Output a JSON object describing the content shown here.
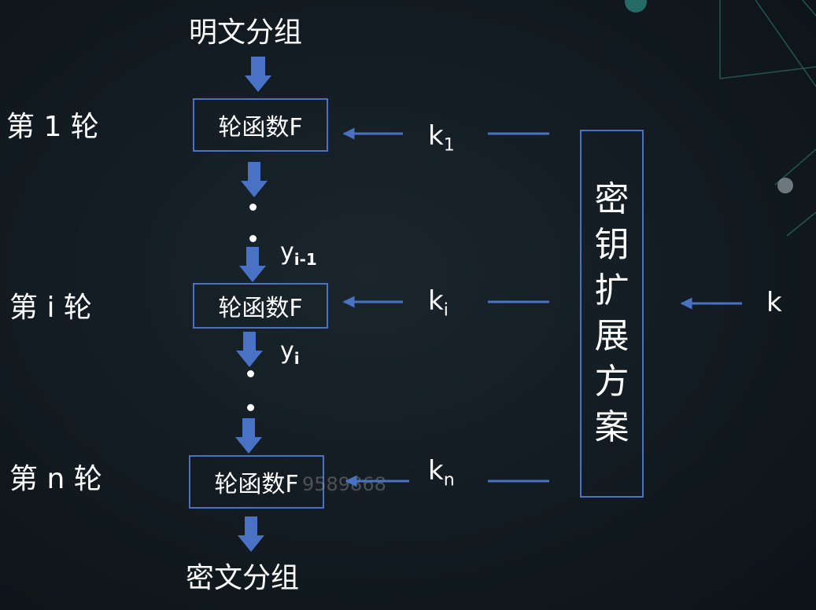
{
  "input_label": "明文分组",
  "output_label": "密文分组",
  "rounds": [
    {
      "label": "第 1 轮",
      "box": "轮函数F",
      "key": "k",
      "key_sub": "1"
    },
    {
      "label": "第 i 轮",
      "box": "轮函数F",
      "key": "k",
      "key_sub": "i"
    },
    {
      "label": "第 n 轮",
      "box": "轮函数F",
      "key": "k",
      "key_sub": "n"
    }
  ],
  "y_prev": {
    "base": "y",
    "sub": "i-1"
  },
  "y_curr": {
    "base": "y",
    "sub": "i"
  },
  "key_schedule": [
    "密",
    "钥",
    "扩",
    "展",
    "方",
    "案"
  ],
  "master_key": "k",
  "watermark": "9589868",
  "colors": {
    "arrow": "#4a72c4",
    "text": "#ffffff",
    "background": "#121b21"
  }
}
